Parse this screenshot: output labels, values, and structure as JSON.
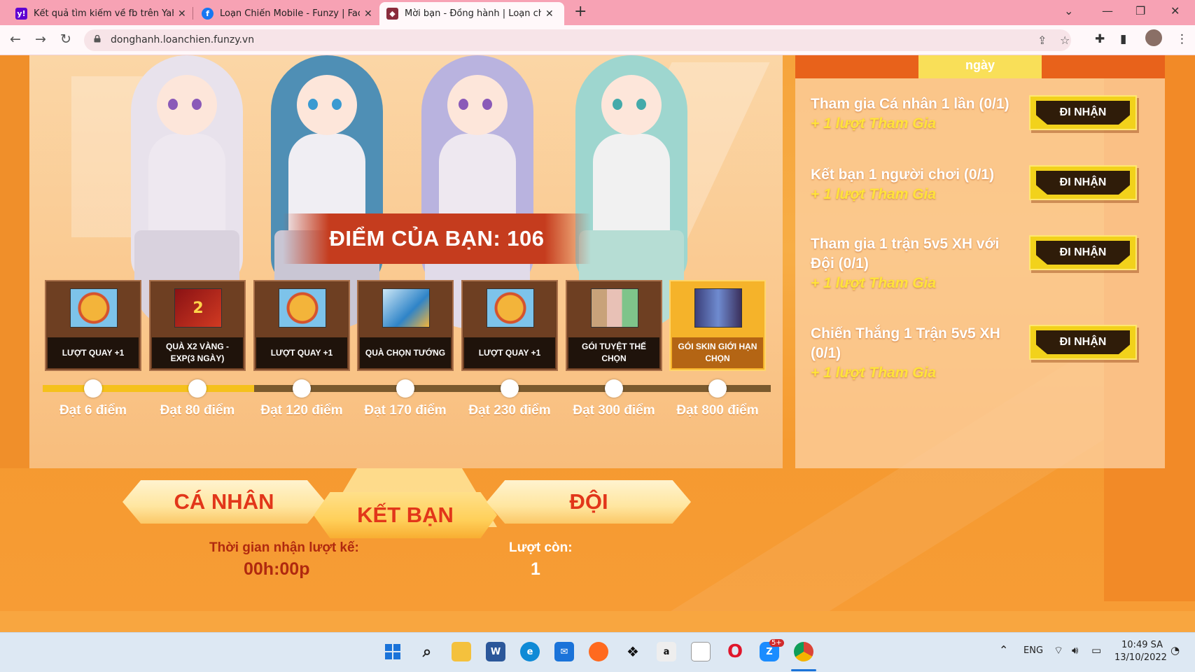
{
  "browser": {
    "tabs": [
      {
        "title": "Kết quả tìm kiếm về fb trên Yaho",
        "icon": "yahoo-icon",
        "color": "#5f01d1"
      },
      {
        "title": "Loạn Chiến Mobile - Funzy | Face",
        "icon": "facebook-icon",
        "color": "#1877f2"
      },
      {
        "title": "Mời bạn - Đồng hành | Loạn chiế",
        "icon": "game-icon",
        "color": "#8a2c3c"
      }
    ],
    "url": "donghanh.loanchien.funzy.vn"
  },
  "page": {
    "score_text": "ĐIỂM CỦA BẠN: 106",
    "rewards": [
      {
        "label": "LƯỢT QUAY +1",
        "icon": "wheel-icon"
      },
      {
        "label": "QUÀ X2 VÀNG - EXP(3 NGÀY)",
        "icon": "gold-x2-icon"
      },
      {
        "label": "LƯỢT QUAY +1",
        "icon": "wheel-icon"
      },
      {
        "label": "QUÀ CHỌN TƯỚNG",
        "icon": "chest-icon"
      },
      {
        "label": "LƯỢT QUAY +1",
        "icon": "wheel-icon"
      },
      {
        "label": "GÓI TUYỆT THẾ CHỌN",
        "icon": "hero-pack-icon"
      },
      {
        "label": "GÓI SKIN GIỚI HẠN CHỌN",
        "icon": "skin-pack-icon"
      }
    ],
    "milestones": [
      "Đạt 6 điểm",
      "Đạt 80 điểm",
      "Đạt 120 điểm",
      "Đạt 170 điểm",
      "Đạt 230 điểm",
      "Đạt 300 điểm",
      "Đạt 800 điểm"
    ],
    "progress_fraction": 0.29,
    "right_tabs": [
      "ngày"
    ],
    "tasks": [
      {
        "title": "Tham gia Cá nhân 1 lần (0/1)",
        "reward": "+ 1 lượt Tham Gia",
        "button": "ĐI NHẬN"
      },
      {
        "title": "Kết bạn 1 người chơi (0/1)",
        "reward": "+ 1 lượt Tham Gia",
        "button": "ĐI NHẬN"
      },
      {
        "title": "Tham gia 1 trận 5v5 XH với Đội (0/1)",
        "reward": "+ 1 lượt Tham Gia",
        "button": "ĐI NHẬN"
      },
      {
        "title": "Chiến Thắng 1 Trận 5v5 XH (0/1)",
        "reward": "+ 1 lượt Tham Gia",
        "button": "ĐI NHẬN"
      }
    ],
    "modes": [
      "CÁ NHÂN",
      "KẾT BẠN",
      "ĐỘI"
    ],
    "next_turn_label": "Thời gian nhận lượt kế:",
    "next_turn_value": "00h:00p",
    "turns_left_label": "Lượt còn:",
    "turns_left_value": "1"
  },
  "taskbar": {
    "apps": [
      "start-icon",
      "search-icon",
      "file-explorer-icon",
      "word-icon",
      "edge-icon",
      "mail-icon",
      "firefox-icon",
      "dropbox-icon",
      "amazon-icon",
      "document-icon",
      "opera-icon",
      "zalo-icon",
      "chrome-icon"
    ],
    "zalo_badge": "5+",
    "language": "ENG",
    "time": "10:49 SA",
    "date": "13/10/2022"
  },
  "colors": {
    "accent": "#c53c1e",
    "button_yellow": "#f2d21b",
    "progress": "#f5c11c"
  }
}
